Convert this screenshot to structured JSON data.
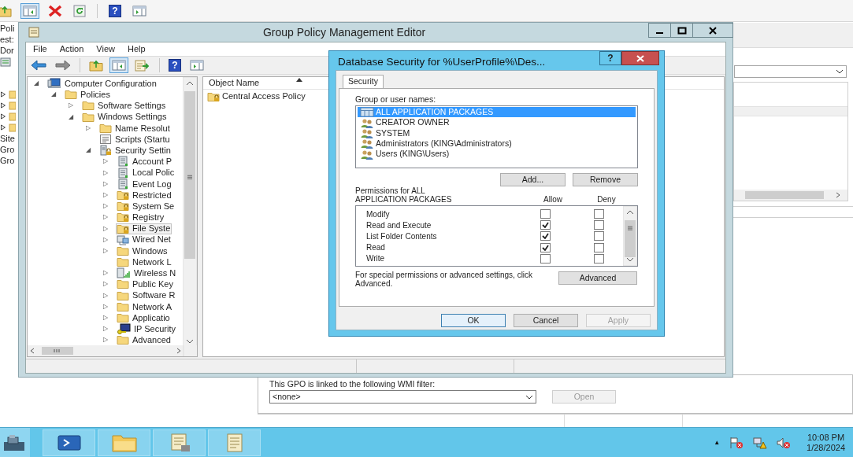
{
  "background_window": {
    "toolbar": [
      {
        "kind": "folder-up",
        "selected": false
      },
      {
        "kind": "console-tree",
        "selected": true
      },
      {
        "kind": "delete",
        "selected": false
      },
      {
        "kind": "refresh",
        "selected": false
      },
      {
        "kind": "help",
        "glyph": "?",
        "selected": false
      },
      {
        "kind": "properties",
        "selected": false
      }
    ],
    "tree_labels_top": [
      "Poli",
      "est:",
      "Dor"
    ],
    "tree_labels_bottom": [
      "Site",
      "Gro",
      "Gro"
    ],
    "wmi_filter": {
      "label": "This GPO is linked to the following WMI filter:",
      "value": "<none>",
      "open_button": {
        "label": "Open",
        "disabled": true
      }
    }
  },
  "editor": {
    "title": "Group Policy Management Editor",
    "menu": [
      "File",
      "Action",
      "View",
      "Help"
    ],
    "toolbar": [
      {
        "kind": "back",
        "selected": false
      },
      {
        "kind": "forward",
        "selected": false
      },
      {
        "kind": "folder-up",
        "selected": false
      },
      {
        "kind": "console-tree",
        "selected": true
      },
      {
        "kind": "export",
        "selected": false
      },
      {
        "kind": "help",
        "glyph": "?",
        "selected": false
      },
      {
        "kind": "properties",
        "selected": false
      }
    ],
    "tree": [
      {
        "label": "Computer Configuration",
        "kind": "computer",
        "toggle": "◢",
        "selected": false,
        "children": [
          {
            "label": "Policies",
            "kind": "folder",
            "toggle": "◢",
            "selected": false,
            "children": [
              {
                "label": "Software Settings",
                "kind": "folder",
                "toggle": "▷",
                "selected": false
              },
              {
                "label": "Windows Settings",
                "kind": "folder",
                "toggle": "◢",
                "selected": false,
                "children": [
                  {
                    "label": "Name Resolut",
                    "kind": "folder",
                    "toggle": "▷",
                    "selected": false
                  },
                  {
                    "label": "Scripts (Startu",
                    "kind": "scripts",
                    "selected": false
                  },
                  {
                    "label": "Security Settin",
                    "kind": "security",
                    "toggle": "◢",
                    "selected": false,
                    "children": [
                      {
                        "label": "Account P",
                        "kind": "policy",
                        "toggle": "▷",
                        "selected": false
                      },
                      {
                        "label": "Local Polic",
                        "kind": "policy",
                        "toggle": "▷",
                        "selected": false
                      },
                      {
                        "label": "Event Log",
                        "kind": "policy",
                        "toggle": "▷",
                        "selected": false
                      },
                      {
                        "label": "Restricted",
                        "kind": "lock-folder",
                        "toggle": "▷",
                        "selected": false
                      },
                      {
                        "label": "System Se",
                        "kind": "lock-folder",
                        "toggle": "▷",
                        "selected": false
                      },
                      {
                        "label": "Registry",
                        "kind": "lock-folder",
                        "toggle": "▷",
                        "selected": false
                      },
                      {
                        "label": "File Syste",
                        "kind": "lock-folder",
                        "toggle": "▷",
                        "selected": true
                      },
                      {
                        "label": "Wired Net",
                        "kind": "network",
                        "toggle": "▷",
                        "selected": false
                      },
                      {
                        "label": "Windows",
                        "kind": "folder",
                        "toggle": "▷",
                        "selected": false
                      },
                      {
                        "label": "Network L",
                        "kind": "folder",
                        "selected": false
                      },
                      {
                        "label": "Wireless N",
                        "kind": "wireless",
                        "toggle": "▷",
                        "selected": false
                      },
                      {
                        "label": "Public Key",
                        "kind": "folder",
                        "toggle": "▷",
                        "selected": false
                      },
                      {
                        "label": "Software R",
                        "kind": "folder",
                        "toggle": "▷",
                        "selected": false
                      },
                      {
                        "label": "Network A",
                        "kind": "folder",
                        "toggle": "▷",
                        "selected": false
                      },
                      {
                        "label": "Applicatio",
                        "kind": "folder",
                        "toggle": "▷",
                        "selected": false
                      },
                      {
                        "label": "IP Security",
                        "kind": "ip-security",
                        "toggle": "▷",
                        "selected": false
                      },
                      {
                        "label": "Advanced",
                        "kind": "folder",
                        "toggle": "▷",
                        "selected": false
                      }
                    ]
                  }
                ]
              }
            ]
          }
        ]
      }
    ],
    "list": {
      "columns": [
        {
          "label": "Object Name",
          "sorted": true
        }
      ],
      "rows": [
        {
          "label": "Central Access Policy",
          "kind": "lock-folder"
        }
      ]
    }
  },
  "dialog": {
    "title": "Database Security for %UserProfile%\\Des...",
    "help_glyph": "?",
    "tabs": [
      {
        "label": "Security",
        "selected": true
      }
    ],
    "names_label": "Group or user names:",
    "names": [
      {
        "label": "ALL APPLICATION PACKAGES",
        "kind": "package",
        "selected": true
      },
      {
        "label": "CREATOR OWNER",
        "kind": "group",
        "selected": false
      },
      {
        "label": "SYSTEM",
        "kind": "group",
        "selected": false
      },
      {
        "label": "Administrators (KING\\Administrators)",
        "kind": "group",
        "selected": false
      },
      {
        "label": "Users (KING\\Users)",
        "kind": "group",
        "selected": false
      }
    ],
    "add_button": "Add...",
    "remove_button": "Remove",
    "permissions_label": "Permissions for ALL APPLICATION PACKAGES",
    "allow_header": "Allow",
    "deny_header": "Deny",
    "permissions": [
      {
        "label": "Modify",
        "allow": false,
        "deny": false
      },
      {
        "label": "Read and Execute",
        "allow": true,
        "deny": false
      },
      {
        "label": "List Folder Contents",
        "allow": true,
        "deny": false
      },
      {
        "label": "Read",
        "allow": true,
        "deny": false
      },
      {
        "label": "Write",
        "allow": false,
        "deny": false
      }
    ],
    "advanced_text": "For special permissions or advanced settings, click Advanced.",
    "advanced_button": "Advanced",
    "buttons": [
      {
        "label": "OK",
        "disabled": false,
        "default": true
      },
      {
        "label": "Cancel",
        "disabled": false,
        "default": false
      },
      {
        "label": "Apply",
        "disabled": true,
        "default": false
      }
    ]
  },
  "taskbar": {
    "apps": [
      {
        "kind": "powershell"
      },
      {
        "kind": "folder"
      },
      {
        "kind": "notes-tool"
      },
      {
        "kind": "notes"
      }
    ],
    "tray_toggle": "▲",
    "tray_icons": [
      {
        "kind": "flag"
      },
      {
        "kind": "network"
      },
      {
        "kind": "speaker"
      }
    ],
    "time": "10:08 PM",
    "date": "1/28/2024"
  }
}
